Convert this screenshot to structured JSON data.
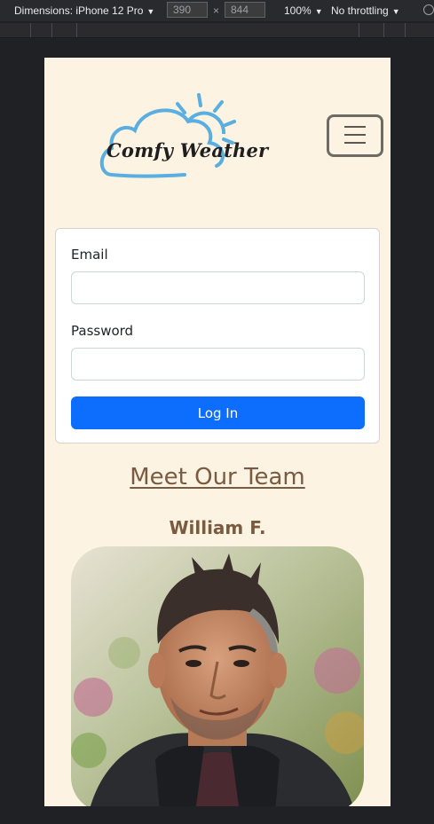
{
  "devtools": {
    "dimensions_label": "Dimensions: iPhone 12 Pro",
    "width": "390",
    "height": "844",
    "times": "×",
    "zoom": "100%",
    "throttle": "No throttling"
  },
  "brand": {
    "logo_text": "Comfy Weather",
    "cloud_color": "#5aaee0",
    "sun_color": "#5aaee0"
  },
  "login": {
    "email_label": "Email",
    "email_value": "",
    "password_label": "Password",
    "password_value": "",
    "submit_label": "Log In"
  },
  "team": {
    "heading": "Meet Our Team",
    "members": [
      {
        "name": "William F."
      }
    ]
  },
  "colors": {
    "page_bg": "#fdf3e3",
    "accent_brown": "#7a5a40",
    "primary_button": "#0d6efd"
  }
}
